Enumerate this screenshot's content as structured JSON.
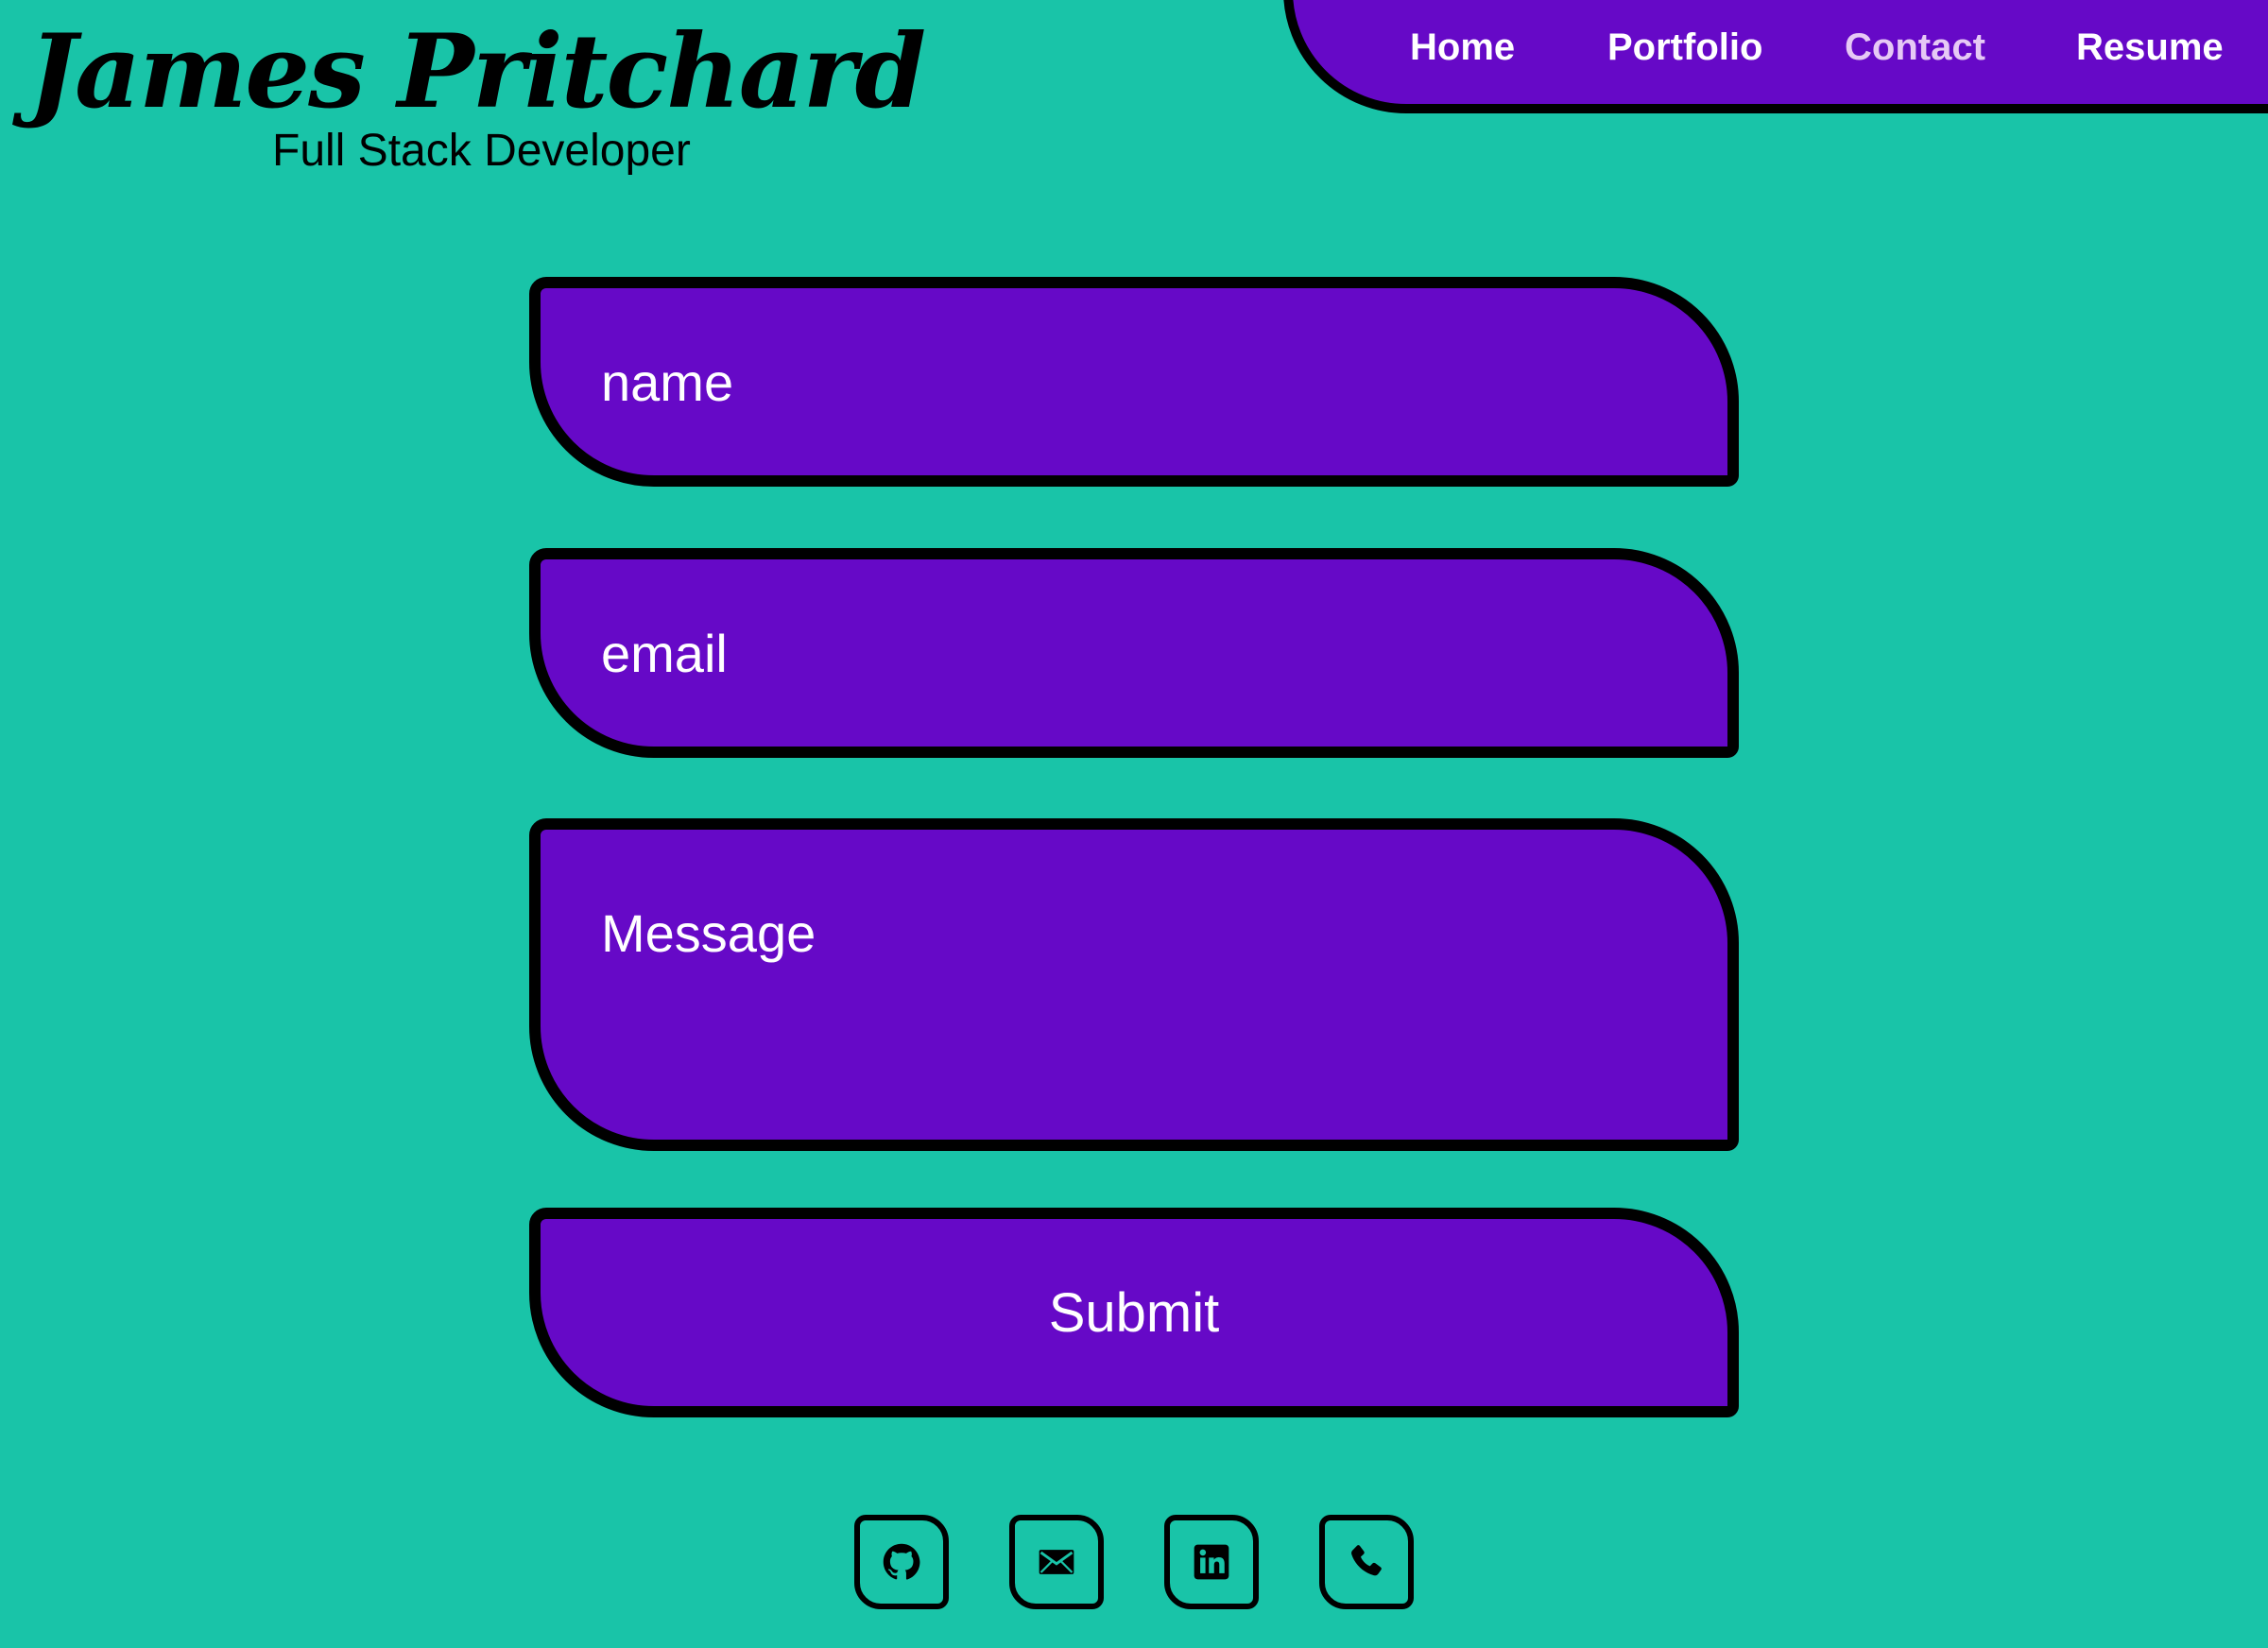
{
  "brand": {
    "name": "James Pritchard",
    "tagline": "Full Stack Developer"
  },
  "nav": {
    "items": [
      {
        "label": "Home",
        "active": false
      },
      {
        "label": "Portfolio",
        "active": false
      },
      {
        "label": "Contact",
        "active": true
      },
      {
        "label": "Resume",
        "active": false
      }
    ]
  },
  "form": {
    "name_placeholder": "name",
    "email_placeholder": "email",
    "message_placeholder": "Message",
    "submit_label": "Submit"
  },
  "social": {
    "items": [
      {
        "icon": "github-icon"
      },
      {
        "icon": "mail-icon"
      },
      {
        "icon": "linkedin-icon"
      },
      {
        "icon": "phone-icon"
      }
    ]
  },
  "colors": {
    "background": "#19c4a8",
    "accent": "#6609c7",
    "border": "#000000",
    "text_on_accent": "#ffffff",
    "nav_active": "#e6c9f5"
  }
}
